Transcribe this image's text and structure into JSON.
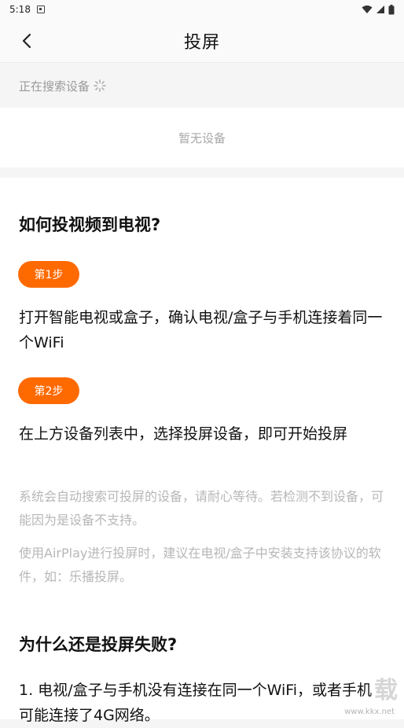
{
  "statusbar": {
    "time": "5:18"
  },
  "header": {
    "title": "投屏"
  },
  "search": {
    "status": "正在搜索设备"
  },
  "devices": {
    "empty_text": "暂无设备"
  },
  "guide": {
    "title": "如何投视频到电视?",
    "steps": [
      {
        "badge": "第1步",
        "text": "打开智能电视或盒子，确认电视/盒子与手机连接着同一个WiFi"
      },
      {
        "badge": "第2步",
        "text": "在上方设备列表中，选择投屏设备，即可开始投屏"
      }
    ],
    "notes": [
      "系统会自动搜索可投屏的设备，请耐心等待。若检测不到设备，可能因为是设备不支持。",
      "使用AirPlay进行投屏时，建议在电视/盒子中安装支持该协议的软件，如：乐播投屏。"
    ]
  },
  "faq": {
    "title": "为什么还是投屏失败?",
    "items": [
      "1. 电视/盒子与手机没有连接在同一个WiFi，或者手机可能连接了4G网络。"
    ]
  },
  "watermark": {
    "text": "载",
    "url": "www.kkx.net"
  }
}
